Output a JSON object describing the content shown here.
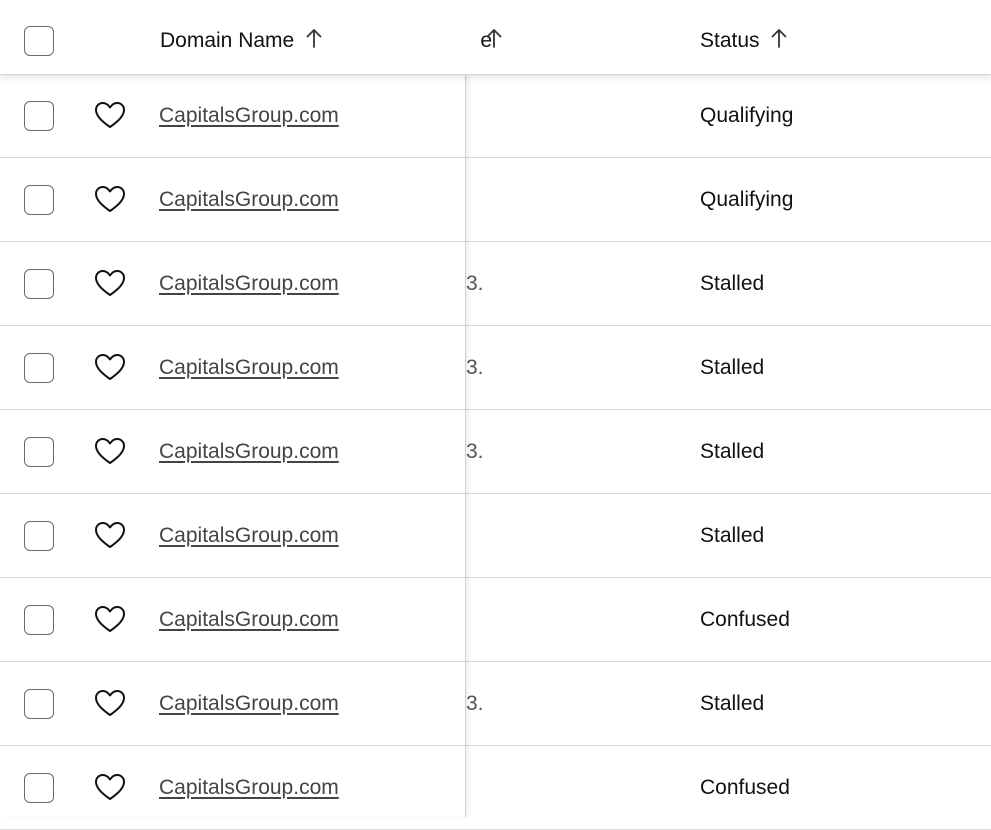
{
  "header": {
    "domain_label": "Domain Name",
    "middle_label_fragment": "e",
    "status_label": "Status",
    "sort_icon": "arrow-up-icon"
  },
  "rows": [
    {
      "domain": "CapitalsGroup.com",
      "middle": "",
      "status": "Qualifying",
      "favorite_icon": "heart-outline-icon"
    },
    {
      "domain": "CapitalsGroup.com",
      "middle": "",
      "status": "Qualifying",
      "favorite_icon": "heart-outline-icon"
    },
    {
      "domain": "CapitalsGroup.com",
      "middle": "3.",
      "status": "Stalled",
      "favorite_icon": "heart-outline-icon"
    },
    {
      "domain": "CapitalsGroup.com",
      "middle": "3.",
      "status": "Stalled",
      "favorite_icon": "heart-outline-icon"
    },
    {
      "domain": "CapitalsGroup.com",
      "middle": "3.",
      "status": "Stalled",
      "favorite_icon": "heart-outline-icon"
    },
    {
      "domain": "CapitalsGroup.com",
      "middle": "",
      "status": "Stalled",
      "favorite_icon": "heart-outline-icon"
    },
    {
      "domain": "CapitalsGroup.com",
      "middle": "",
      "status": "Confused",
      "favorite_icon": "heart-outline-icon"
    },
    {
      "domain": "CapitalsGroup.com",
      "middle": "3.",
      "status": "Stalled",
      "favorite_icon": "heart-outline-icon"
    },
    {
      "domain": "CapitalsGroup.com",
      "middle": "",
      "status": "Confused",
      "favorite_icon": "heart-outline-icon"
    }
  ],
  "colors": {
    "text": "#111111",
    "link": "#444444",
    "border": "#d9d9d9"
  }
}
